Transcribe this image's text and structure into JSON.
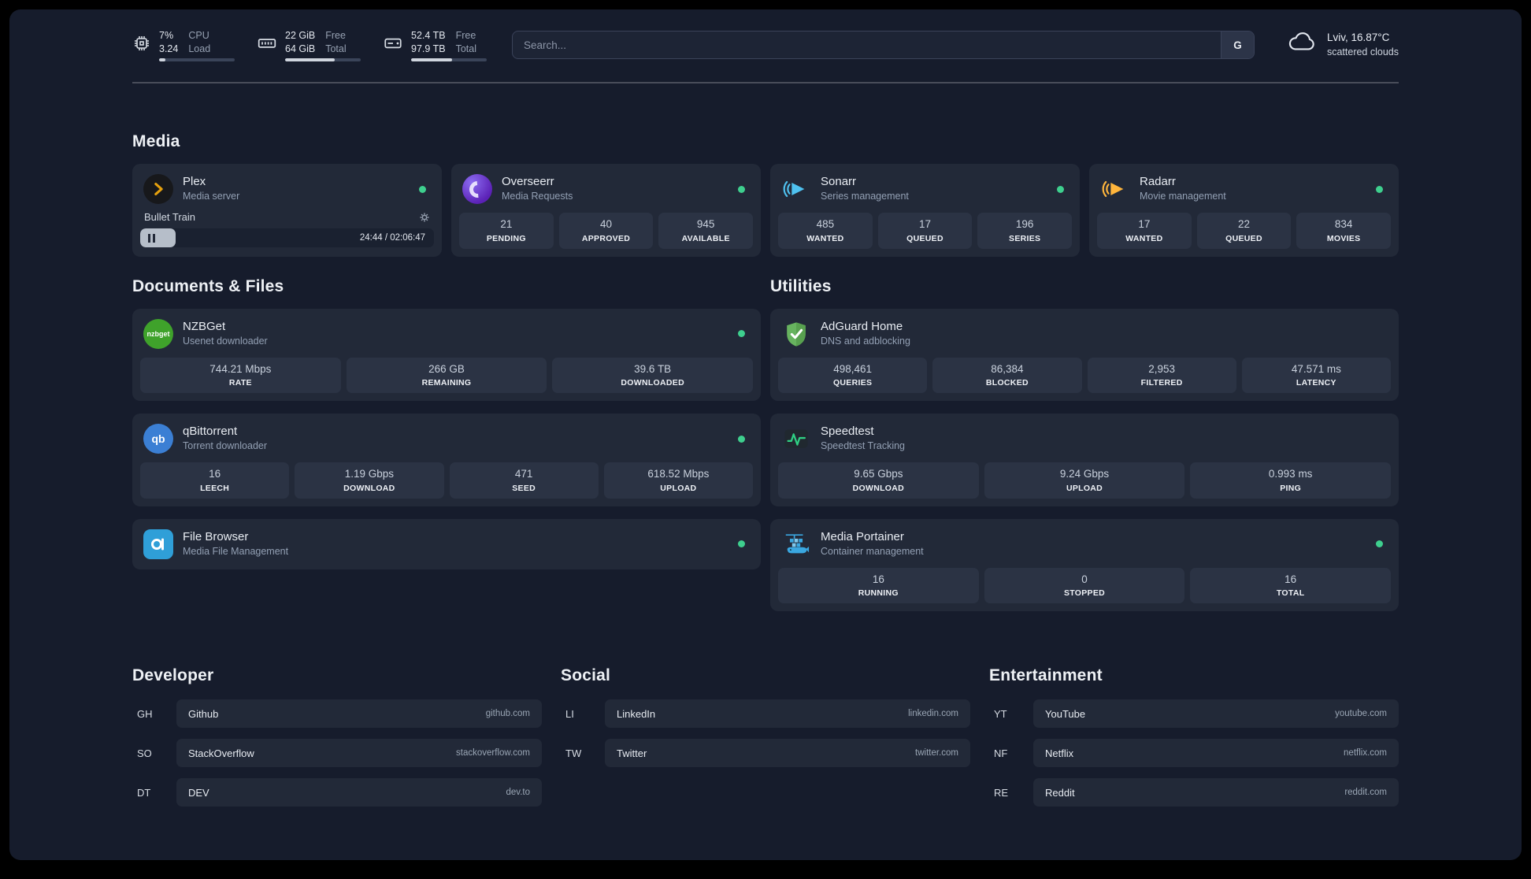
{
  "colors": {
    "status_online": "#3ecf8e"
  },
  "topbar": {
    "cpu": {
      "value1": "7%",
      "value2": "3.24",
      "label1": "CPU",
      "label2": "Load",
      "bar": 8
    },
    "memory": {
      "value1": "22 GiB",
      "value2": "64 GiB",
      "label1": "Free",
      "label2": "Total",
      "bar": 66
    },
    "disk": {
      "value1": "52.4 TB",
      "value2": "97.9 TB",
      "label1": "Free",
      "label2": "Total",
      "bar": 54
    },
    "search": {
      "placeholder": "Search...",
      "provider_button": "G"
    },
    "weather": {
      "location": "Lviv, 16.87°C",
      "condition": "scattered clouds"
    }
  },
  "sections": {
    "media": {
      "title": "Media",
      "plex": {
        "name": "Plex",
        "desc": "Media server",
        "now_playing": "Bullet Train",
        "time": "24:44 / 02:06:47",
        "progress_percent": 12
      },
      "overseerr": {
        "name": "Overseerr",
        "desc": "Media Requests",
        "stats": [
          {
            "value": "21",
            "label": "PENDING"
          },
          {
            "value": "40",
            "label": "APPROVED"
          },
          {
            "value": "945",
            "label": "AVAILABLE"
          }
        ]
      },
      "sonarr": {
        "name": "Sonarr",
        "desc": "Series management",
        "stats": [
          {
            "value": "485",
            "label": "WANTED"
          },
          {
            "value": "17",
            "label": "QUEUED"
          },
          {
            "value": "196",
            "label": "SERIES"
          }
        ]
      },
      "radarr": {
        "name": "Radarr",
        "desc": "Movie management",
        "stats": [
          {
            "value": "17",
            "label": "WANTED"
          },
          {
            "value": "22",
            "label": "QUEUED"
          },
          {
            "value": "834",
            "label": "MOVIES"
          }
        ]
      }
    },
    "documents": {
      "title": "Documents & Files",
      "nzbget": {
        "name": "NZBGet",
        "desc": "Usenet downloader",
        "icon_text": "nzbget",
        "stats": [
          {
            "value": "744.21 Mbps",
            "label": "RATE"
          },
          {
            "value": "266 GB",
            "label": "REMAINING"
          },
          {
            "value": "39.6 TB",
            "label": "DOWNLOADED"
          }
        ]
      },
      "qbittorrent": {
        "name": "qBittorrent",
        "desc": "Torrent downloader",
        "icon_text": "qb",
        "stats": [
          {
            "value": "16",
            "label": "LEECH"
          },
          {
            "value": "1.19 Gbps",
            "label": "DOWNLOAD"
          },
          {
            "value": "471",
            "label": "SEED"
          },
          {
            "value": "618.52 Mbps",
            "label": "UPLOAD"
          }
        ]
      },
      "filebrowser": {
        "name": "File Browser",
        "desc": "Media File Management"
      }
    },
    "utilities": {
      "title": "Utilities",
      "adguard": {
        "name": "AdGuard Home",
        "desc": "DNS and adblocking",
        "stats": [
          {
            "value": "498,461",
            "label": "QUERIES"
          },
          {
            "value": "86,384",
            "label": "BLOCKED"
          },
          {
            "value": "2,953",
            "label": "FILTERED"
          },
          {
            "value": "47.571 ms",
            "label": "LATENCY"
          }
        ]
      },
      "speedtest": {
        "name": "Speedtest",
        "desc": "Speedtest Tracking",
        "stats": [
          {
            "value": "9.65 Gbps",
            "label": "DOWNLOAD"
          },
          {
            "value": "9.24 Gbps",
            "label": "UPLOAD"
          },
          {
            "value": "0.993 ms",
            "label": "PING"
          }
        ]
      },
      "portainer": {
        "name": "Media Portainer",
        "desc": "Container management",
        "stats": [
          {
            "value": "16",
            "label": "RUNNING"
          },
          {
            "value": "0",
            "label": "STOPPED"
          },
          {
            "value": "16",
            "label": "TOTAL"
          }
        ]
      }
    }
  },
  "bookmarks": {
    "developer": {
      "title": "Developer",
      "items": [
        {
          "abbr": "GH",
          "name": "Github",
          "url": "github.com"
        },
        {
          "abbr": "SO",
          "name": "StackOverflow",
          "url": "stackoverflow.com"
        },
        {
          "abbr": "DT",
          "name": "DEV",
          "url": "dev.to"
        }
      ]
    },
    "social": {
      "title": "Social",
      "items": [
        {
          "abbr": "LI",
          "name": "LinkedIn",
          "url": "linkedin.com"
        },
        {
          "abbr": "TW",
          "name": "Twitter",
          "url": "twitter.com"
        }
      ]
    },
    "entertainment": {
      "title": "Entertainment",
      "items": [
        {
          "abbr": "YT",
          "name": "YouTube",
          "url": "youtube.com"
        },
        {
          "abbr": "NF",
          "name": "Netflix",
          "url": "netflix.com"
        },
        {
          "abbr": "RE",
          "name": "Reddit",
          "url": "reddit.com"
        }
      ]
    }
  }
}
